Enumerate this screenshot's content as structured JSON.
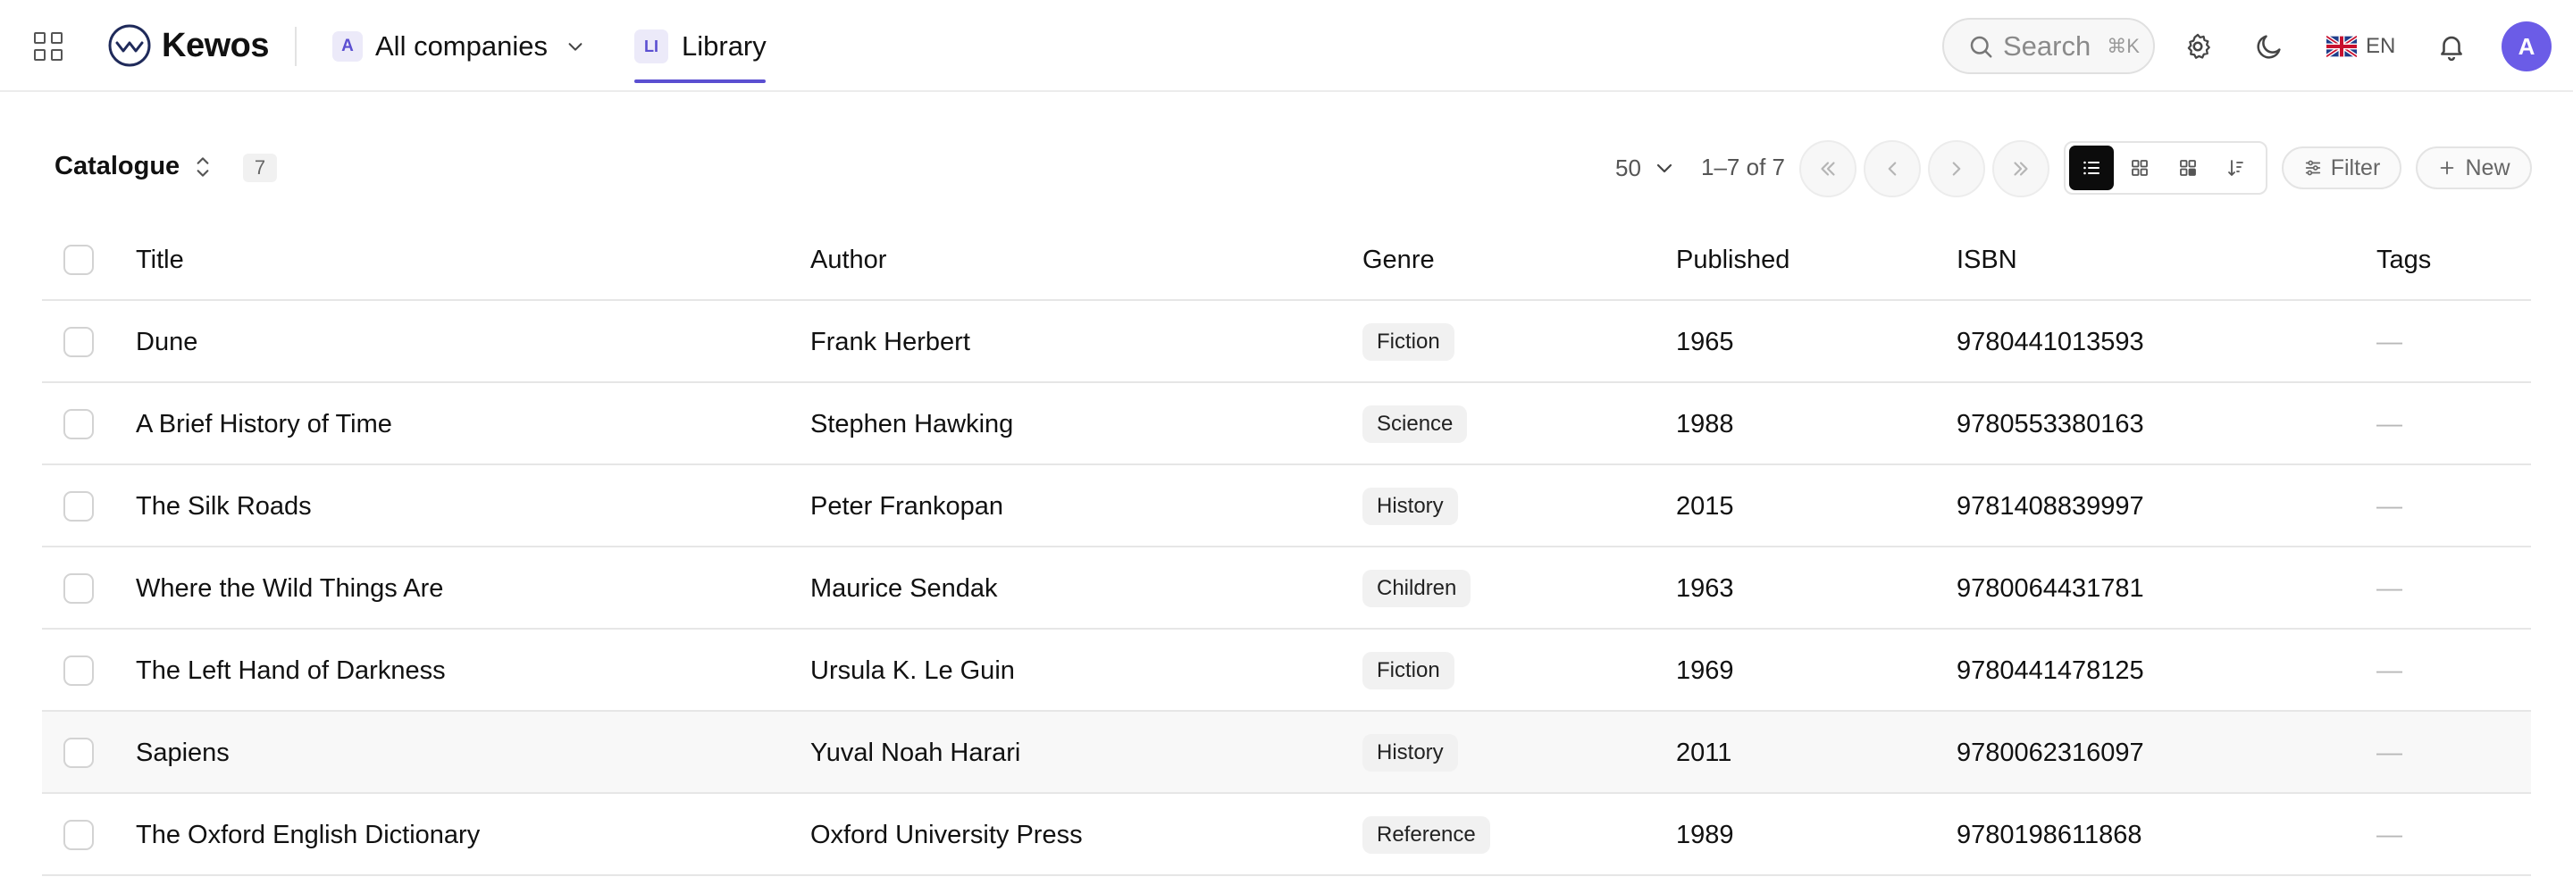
{
  "app": {
    "name": "Kewos"
  },
  "header": {
    "company": {
      "badge": "A",
      "label": "All companies"
    },
    "tab": {
      "badge": "LI",
      "label": "Library"
    },
    "search": {
      "placeholder": "Search",
      "shortcut": "⌘K"
    },
    "language": {
      "code": "EN",
      "flag": "uk-flag-icon"
    },
    "avatar": {
      "initial": "A"
    }
  },
  "toolbar": {
    "title": "Catalogue",
    "count": "7",
    "per_page": "50",
    "page_info": "1–7 of 7",
    "filter_label": "Filter",
    "new_label": "New",
    "active_view": "list"
  },
  "table": {
    "columns": [
      "Title",
      "Author",
      "Genre",
      "Published",
      "ISBN",
      "Tags"
    ],
    "rows": [
      {
        "title": "Dune",
        "author": "Frank Herbert",
        "genre": "Fiction",
        "published": "1965",
        "isbn": "9780441013593",
        "tags": "—"
      },
      {
        "title": "A Brief History of Time",
        "author": "Stephen Hawking",
        "genre": "Science",
        "published": "1988",
        "isbn": "9780553380163",
        "tags": "—"
      },
      {
        "title": "The Silk Roads",
        "author": "Peter Frankopan",
        "genre": "History",
        "published": "2015",
        "isbn": "9781408839997",
        "tags": "—"
      },
      {
        "title": "Where the Wild Things Are",
        "author": "Maurice Sendak",
        "genre": "Children",
        "published": "1963",
        "isbn": "9780064431781",
        "tags": "—"
      },
      {
        "title": "The Left Hand of Darkness",
        "author": "Ursula K. Le Guin",
        "genre": "Fiction",
        "published": "1969",
        "isbn": "9780441478125",
        "tags": "—"
      },
      {
        "title": "Sapiens",
        "author": "Yuval Noah Harari",
        "genre": "History",
        "published": "2011",
        "isbn": "9780062316097",
        "tags": "—"
      },
      {
        "title": "The Oxford English Dictionary",
        "author": "Oxford University Press",
        "genre": "Reference",
        "published": "1989",
        "isbn": "9780198611868",
        "tags": "—"
      }
    ]
  },
  "colors": {
    "accent": "#5b4fd1",
    "avatar_bg": "#6b5ce7",
    "active_view_bg": "#0c0c0c"
  }
}
